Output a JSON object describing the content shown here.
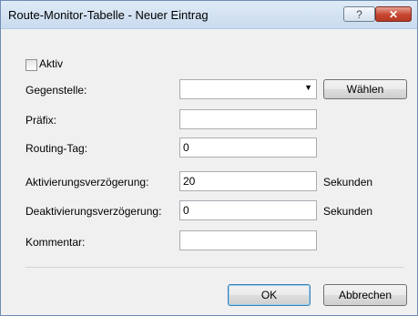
{
  "window": {
    "title": "Route-Monitor-Tabelle - Neuer Eintrag",
    "help_label": "?",
    "close_label": "✕"
  },
  "form": {
    "aktiv": {
      "label": "Aktiv",
      "checked": false
    },
    "gegenstelle": {
      "label": "Gegenstelle:",
      "value": "",
      "button_label": "Wählen"
    },
    "praefix": {
      "label": "Präfix:",
      "value": ""
    },
    "routing_tag": {
      "label": "Routing-Tag:",
      "value": "0"
    },
    "aktivierungsverzoegerung": {
      "label": "Aktivierungsverzögerung:",
      "value": "20",
      "unit": "Sekunden"
    },
    "deaktivierungsverzoegerung": {
      "label": "Deaktivierungsverzögerung:",
      "value": "0",
      "unit": "Sekunden"
    },
    "kommentar": {
      "label": "Kommentar:",
      "value": ""
    }
  },
  "footer": {
    "ok_label": "OK",
    "cancel_label": "Abbrechen"
  },
  "icons": {
    "dropdown": "chevron-down-icon"
  }
}
